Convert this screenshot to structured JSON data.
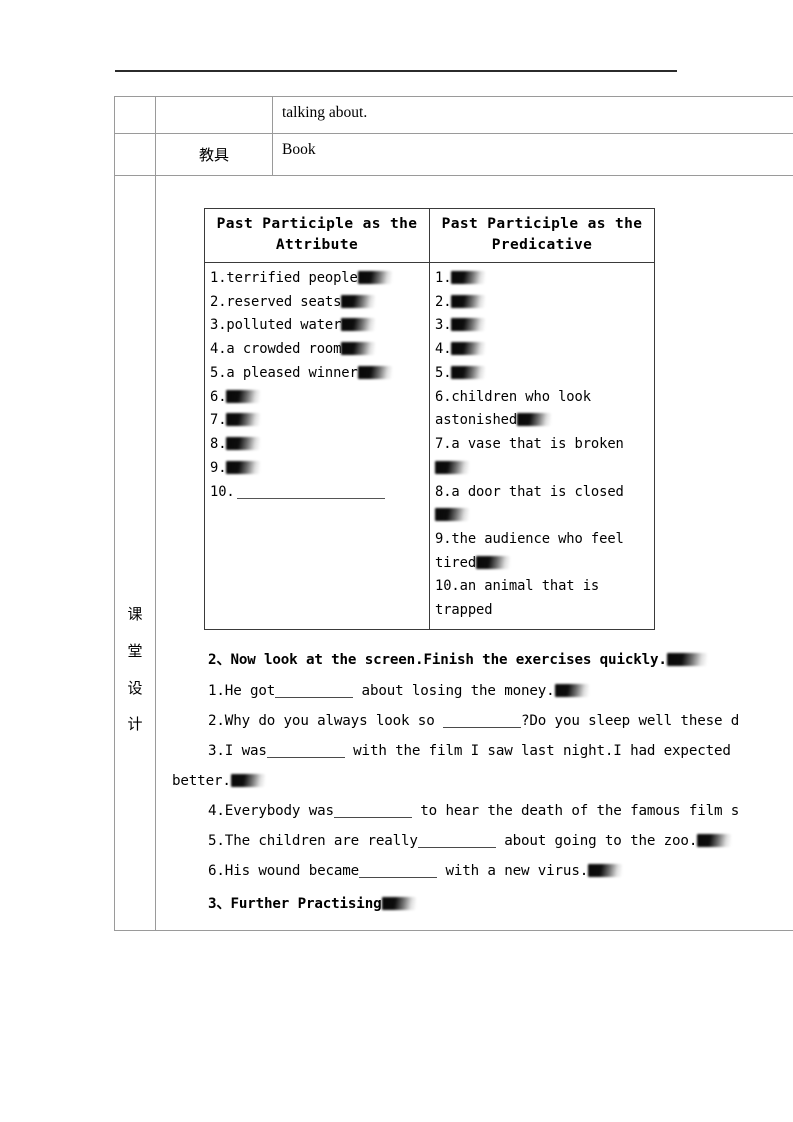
{
  "document": {
    "header_rule": true,
    "spine_label_chars": [
      "课",
      "堂",
      "设",
      "计"
    ],
    "rows": {
      "talking_about": "talking about.",
      "tools_label": "教具",
      "tools_value": "Book"
    }
  },
  "grammar_table": {
    "headers": [
      "Past Participle as the Attribute",
      "Past Participle as the Predicative"
    ],
    "attribute_items": [
      {
        "num": "1.",
        "text": "terrified people",
        "redacted": "md"
      },
      {
        "num": "2.",
        "text": "reserved seats",
        "redacted": "md"
      },
      {
        "num": "3.",
        "text": "polluted water",
        "redacted": "md"
      },
      {
        "num": "4.",
        "text": "a crowded room",
        "redacted": "md"
      },
      {
        "num": "5.",
        "text": "a pleased winner",
        "redacted": "md"
      },
      {
        "num": "6.",
        "text": "",
        "redacted": "md"
      },
      {
        "num": "7.",
        "text": "",
        "redacted": "md"
      },
      {
        "num": "8.",
        "text": "",
        "redacted": "md"
      },
      {
        "num": "9.",
        "text": "",
        "redacted": "md"
      },
      {
        "num": "10.",
        "text": "",
        "redacted": "none",
        "blank_rule": true
      }
    ],
    "predicative_items": [
      {
        "num": "1.",
        "text": "",
        "redacted": "md"
      },
      {
        "num": "2.",
        "text": "",
        "redacted": "md"
      },
      {
        "num": "3.",
        "text": "",
        "redacted": "md"
      },
      {
        "num": "4.",
        "text": "",
        "redacted": "md"
      },
      {
        "num": "5.",
        "text": "",
        "redacted": "md"
      },
      {
        "num": "6.",
        "text": "children who look astonished",
        "redacted": "md"
      },
      {
        "num": "7.",
        "text": "a vase that is broken",
        "redacted": "md"
      },
      {
        "num": "8.",
        "text": "a door that is closed",
        "redacted": "md"
      },
      {
        "num": "9.",
        "text": "the audience who feel tired",
        "redacted": "md"
      },
      {
        "num": "10.",
        "text": "an animal that is trapped",
        "redacted": "none"
      }
    ]
  },
  "exercises": {
    "section_heading": {
      "num": "2、",
      "text": "Now look at the screen.Finish the exercises quickly.",
      "redacted": "lg"
    },
    "items": [
      {
        "num": "1.",
        "before": "He got",
        "after": " about losing the money.",
        "redacted": "md",
        "wrap": null
      },
      {
        "num": "2.",
        "before": "Why do you always look so ",
        "after": "?Do you sleep well these d",
        "redacted": "none",
        "wrap": null
      },
      {
        "num": "3.",
        "before": "I was",
        "after": " with the film I saw last night.I had expected",
        "redacted": "none",
        "wrap": "better.",
        "wrap_redacted": "md"
      },
      {
        "num": "4.",
        "before": "Everybody was",
        "after": " to hear the death of the famous film s",
        "redacted": "none",
        "wrap": null
      },
      {
        "num": "5.",
        "before": "The children are really",
        "after": " about going to the zoo.",
        "redacted": "md",
        "wrap": null
      },
      {
        "num": "6.",
        "before": "His wound became",
        "after": " with a new virus.",
        "redacted": "md",
        "wrap": null
      }
    ],
    "further_heading": {
      "num": "3、",
      "text": "Further  Practising",
      "redacted": "md"
    }
  }
}
